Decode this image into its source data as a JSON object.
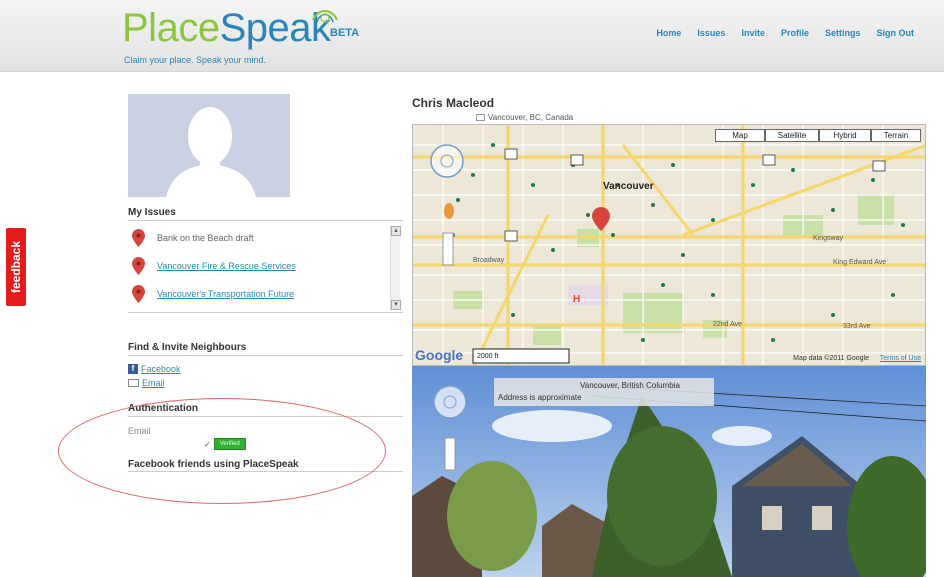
{
  "header": {
    "logo_place": "Place",
    "logo_speak": "Speak",
    "beta": "BETA",
    "tagline": "Claim your place. Speak your mind.",
    "nav": [
      "Home",
      "Issues",
      "Invite",
      "Profile",
      "Settings",
      "Sign Out"
    ]
  },
  "feedback_label": "feedback",
  "sidebar": {
    "my_issues_title": "My Issues",
    "issues": [
      {
        "label": "Bank on the Beach draft"
      },
      {
        "label": "Vancouver Fire & Rescue Services"
      },
      {
        "label": "Vancouver's Transportation Future"
      }
    ],
    "find_invite_title": "Find & Invite Neighbours",
    "facebook_label": "Facebook",
    "email_label": "Email",
    "authentication_title": "Authentication",
    "auth_email_label": "Email",
    "verified_label": "Verified",
    "facebook_friends_title": "Facebook friends using PlaceSpeak"
  },
  "profile": {
    "name": "Chris Macleod",
    "location": "Vancouver, BC, Canada"
  },
  "map": {
    "types": [
      "Map",
      "Satellite",
      "Hybrid",
      "Terrain"
    ],
    "city_label": "Vancouver",
    "scale_label": "2000 ft",
    "attribution": "Map data ©2011 Google",
    "terms": "Terms of Use",
    "google": "Google",
    "labels": [
      "King Edward Ave",
      "Broadway",
      "22nd Ave",
      "33rd Ave",
      "Kingsway"
    ]
  },
  "streetview": {
    "place": "Vancouver, British Columbia",
    "note": "Address is approximate"
  }
}
